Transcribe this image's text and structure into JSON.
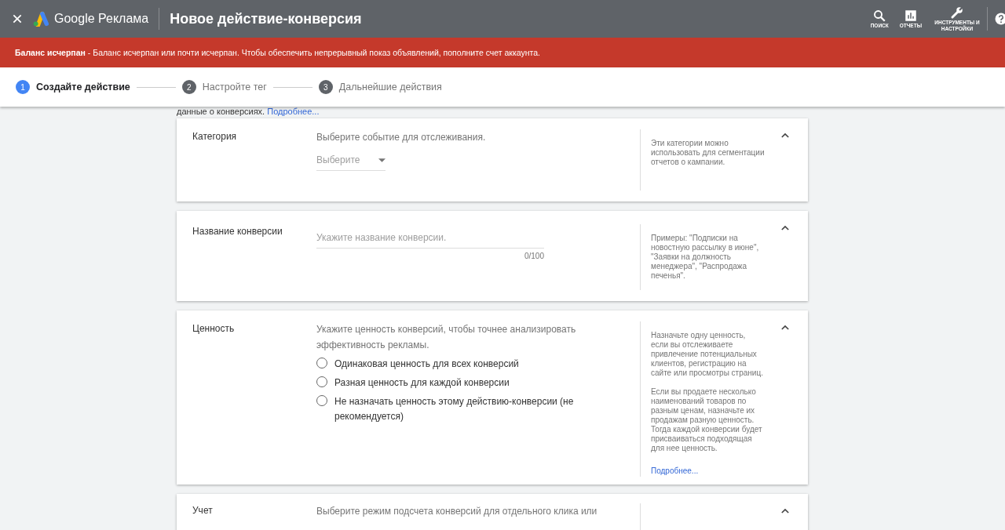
{
  "header": {
    "product": "Google Реклама",
    "title": "Новое действие-конверсия",
    "tools": [
      {
        "kind": "search",
        "label": "ПОИСК"
      },
      {
        "kind": "reports",
        "label": "ОТЧЕТЫ"
      },
      {
        "kind": "tools",
        "label": "ИНСТРУМЕНТЫ И НАСТРОЙКИ"
      }
    ]
  },
  "banner": {
    "bold": "Баланс исчерпан",
    "text": " - Баланс исчерпан или почти исчерпан. Чтобы обеспечить непрерывный показ объявлений, пополните счет аккаунта."
  },
  "steps": [
    {
      "number": "1",
      "label": "Создайте действие",
      "selected": true
    },
    {
      "number": "2",
      "label": "Настройте тег",
      "selected": false
    },
    {
      "number": "3",
      "label": "Дальнейшие действия",
      "selected": false
    }
  ],
  "intro": {
    "text": "данные о конверсиях.",
    "link": "Подробнее..."
  },
  "sections": [
    {
      "kind": "select",
      "label": "Категория",
      "description": "Выберите событие для отслеживания.",
      "placeholder": "Выберите",
      "help": [
        "Эти категории можно использовать для сегментации отчетов о кампании."
      ],
      "expanded": true
    },
    {
      "kind": "text",
      "label": "Название конверсии",
      "placeholder": "Укажите название конверсии.",
      "counter": "0/100",
      "help": [
        "Примеры: \"Подписки на новостную рассылку в июне\", \"Заявки на должность менеджера\", \"Распродажа печенья\"."
      ],
      "expanded": true
    },
    {
      "kind": "radio",
      "label": "Ценность",
      "description": "Укажите ценность конверсий, чтобы точнее анализировать эффективность рекламы.",
      "options": [
        {
          "label": "Одинаковая ценность для всех конверсий",
          "selected": false
        },
        {
          "label": "Разная ценность для каждой конверсии",
          "selected": false
        },
        {
          "label": "Не назначать ценность этому действию-конверсии (не рекомендуется)",
          "selected": false
        }
      ],
      "help": [
        "Назначьте одну ценность, если вы отслеживаете привлечение потенциальных клиентов, регистрацию на сайте или просмотры страниц.",
        "Если вы продаете несколько наименований товаров по разным ценам, назначьте их продажам разную ценность. Тогда каждой конверсии будет присваиваться подходящая для нее ценность."
      ],
      "help_link": "Подробнее...",
      "expanded": true
    },
    {
      "kind": "partial",
      "label": "Учет",
      "description": "Выберите режим подсчета конверсий для отдельного клика или",
      "expanded": true
    }
  ]
}
